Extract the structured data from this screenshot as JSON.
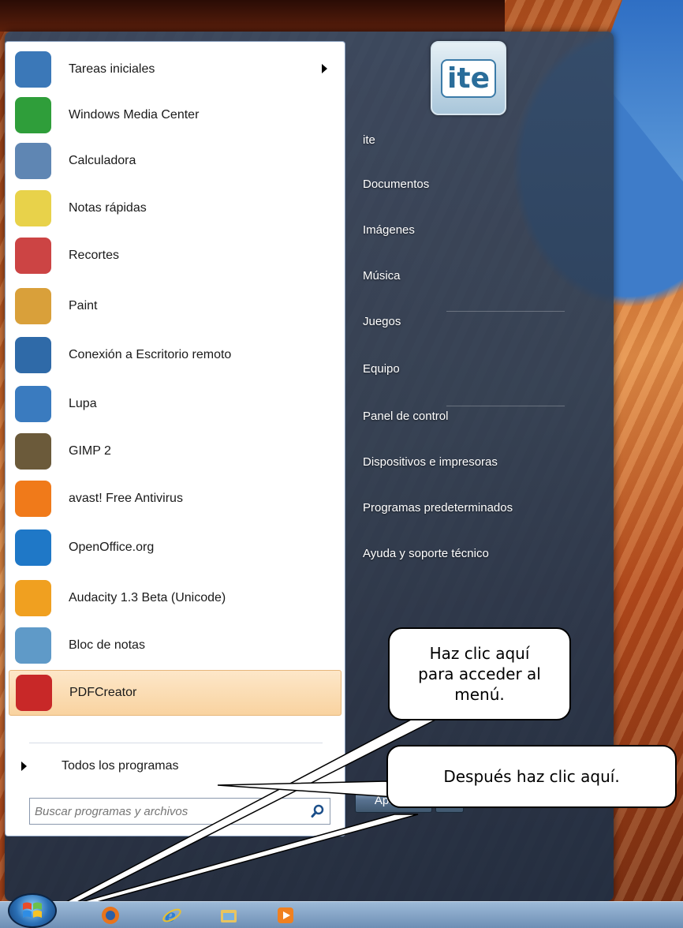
{
  "start_menu": {
    "programs": [
      {
        "label": "Tareas iniciales",
        "icon": "getting-started-icon",
        "color": "#3b78b8",
        "has_submenu": true
      },
      {
        "label": "Windows Media Center",
        "icon": "media-center-icon",
        "color": "#2f9e3a"
      },
      {
        "label": "Calculadora",
        "icon": "calculator-icon",
        "color": "#5f86b3"
      },
      {
        "label": "Notas rápidas",
        "icon": "sticky-notes-icon",
        "color": "#e8d24a"
      },
      {
        "label": "Recortes",
        "icon": "snipping-tool-icon",
        "color": "#c44"
      },
      {
        "label": "Paint",
        "icon": "paint-icon",
        "color": "#d9a03a"
      },
      {
        "label": "Conexión a Escritorio remoto",
        "icon": "remote-desktop-icon",
        "color": "#2f6aa8"
      },
      {
        "label": "Lupa",
        "icon": "magnifier-icon",
        "color": "#3a7bbf"
      },
      {
        "label": "GIMP 2",
        "icon": "gimp-icon",
        "color": "#6b5a3a"
      },
      {
        "label": "avast! Free Antivirus",
        "icon": "avast-icon",
        "color": "#f07a1a"
      },
      {
        "label": "OpenOffice.org",
        "icon": "openoffice-icon",
        "color": "#1f78c7"
      },
      {
        "label": "Audacity 1.3 Beta (Unicode)",
        "icon": "audacity-icon",
        "color": "#f0a020"
      },
      {
        "label": "Bloc de notas",
        "icon": "notepad-icon",
        "color": "#5f9ac8"
      },
      {
        "label": "PDFCreator",
        "icon": "pdfcreator-icon",
        "color": "#c82828",
        "highlighted": true
      }
    ],
    "all_programs_label": "Todos los programas",
    "search_placeholder": "Buscar programas y archivos",
    "user_name": "ite",
    "user_tile_text": "ite",
    "right_items": [
      {
        "label": "ite"
      },
      {
        "label": "Documentos"
      },
      {
        "label": "Imágenes"
      },
      {
        "label": "Música"
      },
      {
        "label": "Juegos"
      },
      {
        "label": "Equipo"
      },
      {
        "label": "Panel de control"
      },
      {
        "label": "Dispositivos e impresoras"
      },
      {
        "label": "Programas predeterminados"
      },
      {
        "label": "Ayuda y soporte técnico"
      }
    ],
    "shutdown_label": "Apagar"
  },
  "callouts": {
    "first": "Haz clic aquí para acceder al menú.",
    "second": "Después haz clic aquí."
  },
  "taskbar": {
    "icons": [
      "start-orb-icon",
      "firefox-icon",
      "internet-explorer-icon",
      "file-explorer-icon",
      "media-player-icon"
    ]
  },
  "colors": {
    "menu_bg": "#2e435c",
    "highlight": "#f9d3a0",
    "taskbar": "#8aa9cc"
  }
}
